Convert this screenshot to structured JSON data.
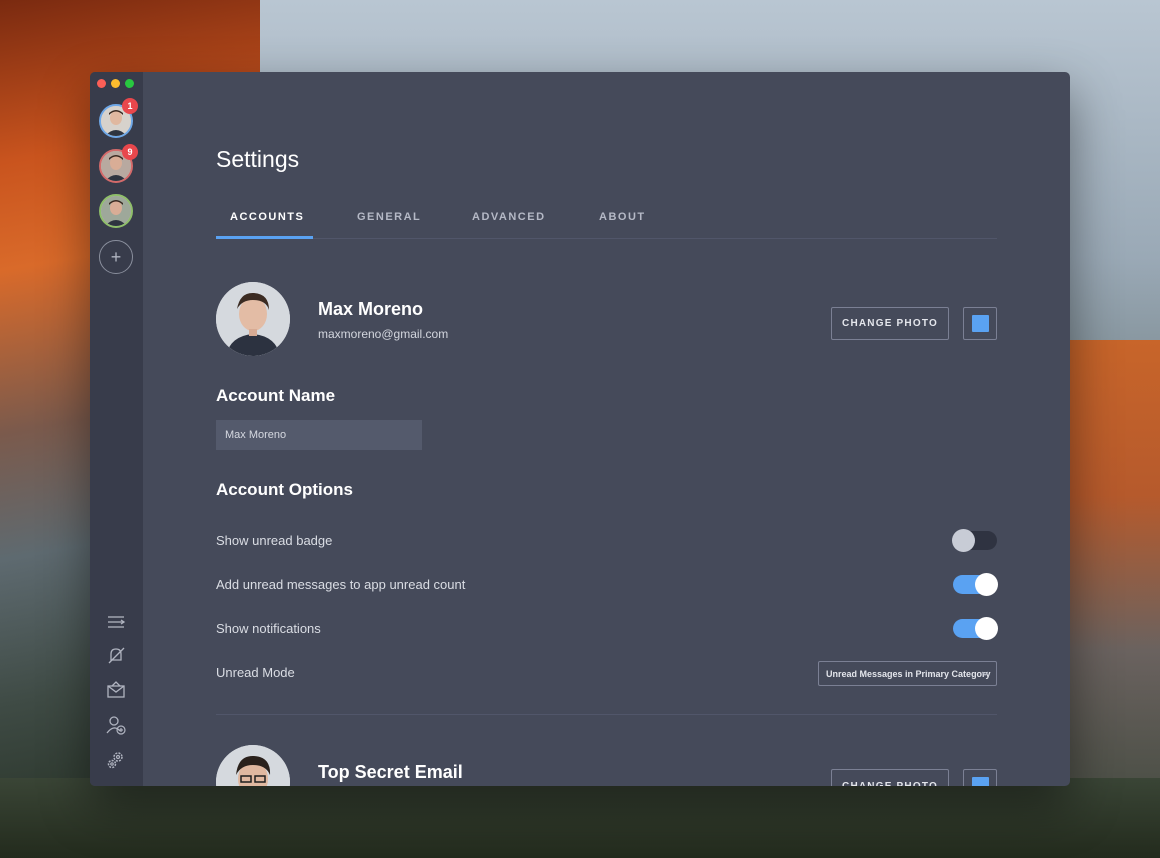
{
  "sidebar": {
    "accounts": [
      {
        "badge": "1"
      },
      {
        "badge": "9"
      },
      {
        "badge": ""
      }
    ],
    "add_label": "+",
    "bottom_icons": [
      "menu-icon",
      "do-not-disturb-icon",
      "envelope-icon",
      "add-user-icon",
      "settings-icon"
    ]
  },
  "page": {
    "title": "Settings"
  },
  "tabs": [
    {
      "label": "ACCOUNTS",
      "active": true
    },
    {
      "label": "GENERAL",
      "active": false
    },
    {
      "label": "ADVANCED",
      "active": false
    },
    {
      "label": "ABOUT",
      "active": false
    }
  ],
  "profile": {
    "name": "Max Moreno",
    "email": "maxmoreno@gmail.com",
    "change_photo_label": "CHANGE PHOTO",
    "color": "#5aa2f2"
  },
  "account_name": {
    "heading": "Account Name",
    "value": "Max Moreno"
  },
  "options": {
    "heading": "Account Options",
    "items": [
      {
        "label": "Show unread badge",
        "enabled": false
      },
      {
        "label": "Add unread messages to app unread count",
        "enabled": true
      },
      {
        "label": "Show notifications",
        "enabled": true
      }
    ],
    "unread_mode_label": "Unread Mode",
    "unread_mode_value": "Unread Messages in Primary Category"
  },
  "profile2": {
    "name": "Top Secret Email",
    "change_photo_label": "CHANGE PHOTO"
  },
  "colors": {
    "accent": "#5aa2f2",
    "badge": "#e8474c",
    "window_bg": "#454a5a",
    "sidebar_bg": "#383c4b"
  }
}
